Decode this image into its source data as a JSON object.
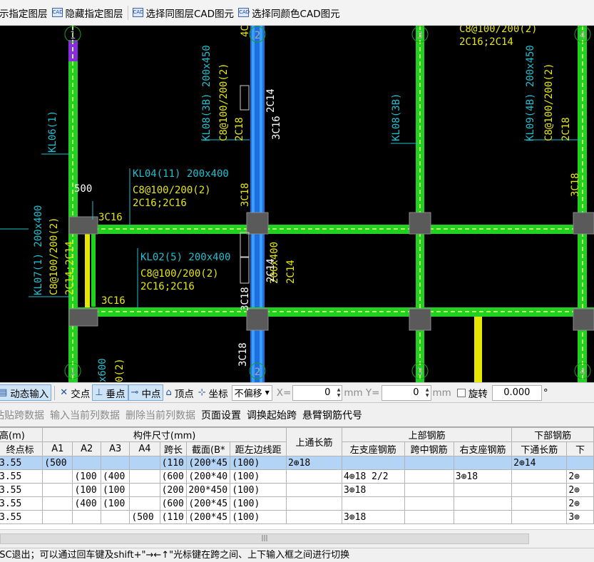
{
  "toolbar": {
    "items": [
      {
        "label": "示指定图层",
        "icon": "layer-show-icon"
      },
      {
        "label": "隐藏指定图层",
        "icon": "cad-layer-hide-icon"
      },
      {
        "label": "选择同图层CAD图元",
        "icon": "cad-select-layer-icon"
      },
      {
        "label": "选择同颜色CAD图元",
        "icon": "cad-select-color-icon"
      }
    ]
  },
  "cad": {
    "axis_labels": [
      "1",
      "2",
      "3",
      "4",
      "1",
      "2",
      "3",
      "4"
    ],
    "texts": {
      "kl06": "KL06(1)",
      "kl08": "KL08(3B) 200x450",
      "kl08_stirrup": "C8@100/200(2)",
      "kl08_top": "2C18",
      "kl08_right_a": "2C14",
      "kl08_right_b": "3C16",
      "kl08b": "KL08(3B)",
      "kl09": "KL09(4B) 200x450",
      "kl09_stirrup": "C8@100/200(2)",
      "kl09_top": "2C18",
      "top_stirrup": "C8@100/200(2)",
      "top_bars": "2C16;2C14",
      "kl04": "KL04(11) 200x400",
      "kl04_stirrup": "C8@100/200(2)",
      "kl04_bars": "2C16;2C16",
      "dim_500": "500",
      "c16_a": "3C16",
      "c16_b": "3C16",
      "c18_a": "3C18",
      "c18_b": "3C18",
      "c18_c": "3C18",
      "c18_d": "3C18",
      "kl02": "KL02(5) 200x400",
      "kl02_stirrup": "C8@100/200(2)",
      "kl02_bars": "2C16;2C16",
      "kl07": "KL07(1) 200x400",
      "kl07_stirrup": "C8@100/200(2)",
      "kl07_bars": "2C14;2C14",
      "mid_dim": "200x400",
      "mid_c14": "2C14",
      "mid_c14b": "2C14",
      "bottom_a": "x600",
      "bottom_b": "0(2)",
      "top_4c": "4C"
    }
  },
  "snapbar": {
    "dynamic_input": "动态输入",
    "intersection": "交点",
    "perpendicular": "垂点",
    "midpoint": "中点",
    "vertex": "顶点",
    "coordinate": "坐标",
    "offset_mode": "不偏移",
    "x_label": "X=",
    "x_value": "0",
    "y_label": "mm Y=",
    "y_value": "0",
    "mm_label": "mm",
    "rotate_label": "旋转",
    "rotate_value": "0.000",
    "degree": "°"
  },
  "menu": {
    "items": [
      {
        "label": "粘贴跨数据",
        "enabled": false
      },
      {
        "label": "输入当前列数据",
        "enabled": false
      },
      {
        "label": "删除当前列数据",
        "enabled": false
      },
      {
        "label": "页面设置",
        "enabled": true
      },
      {
        "label": "调换起始跨",
        "enabled": true
      },
      {
        "label": "悬臂钢筋代号",
        "enabled": true
      }
    ]
  },
  "table": {
    "group_headers": {
      "elevation": "高(m)",
      "size": "构件尺寸(mm)",
      "top_through": "上通长筋",
      "top_rebar": "上部钢筋",
      "bottom_rebar": "下部钢筋"
    },
    "columns": [
      "终点标",
      "A1",
      "A2",
      "A3",
      "A4",
      "跨长",
      "截面(B*",
      "距左边线距",
      "",
      "左支座钢筋",
      "跨中钢筋",
      "右支座钢筋",
      "下通长筋",
      "下"
    ],
    "rows": [
      [
        "3.55",
        "(500",
        "",
        "",
        "",
        "(110",
        "(200*45",
        "(100)",
        "2⊕18",
        "",
        "",
        "",
        "2⊕14",
        ""
      ],
      [
        "3.55",
        "",
        "(100",
        "(400",
        "",
        "(600",
        "(200*40",
        "(100)",
        "",
        "4⊕18 2/2",
        "",
        "3⊕18",
        "",
        "2⊕"
      ],
      [
        "3.55",
        "",
        "(100",
        "(100",
        "",
        "(200",
        "200*450",
        "(100)",
        "",
        "3⊕18",
        "",
        "",
        "",
        "2⊕"
      ],
      [
        "3.55",
        "",
        "(400",
        "(100",
        "",
        "(600",
        "(200*45",
        "(100)",
        "",
        "",
        "",
        "",
        "",
        "2⊕"
      ],
      [
        "3.55",
        "",
        "",
        "",
        "(500",
        "(110",
        "(200*45",
        "(100)",
        "",
        "3⊕18",
        "",
        "",
        "",
        "3⊕"
      ]
    ],
    "selected_row": 0
  },
  "hscroll": {
    "grip": "|||"
  },
  "hint": "ESC退出；可以通过回车键及shift+\"→←↑\"光标键在跨之间、上下输入框之间进行切换"
}
